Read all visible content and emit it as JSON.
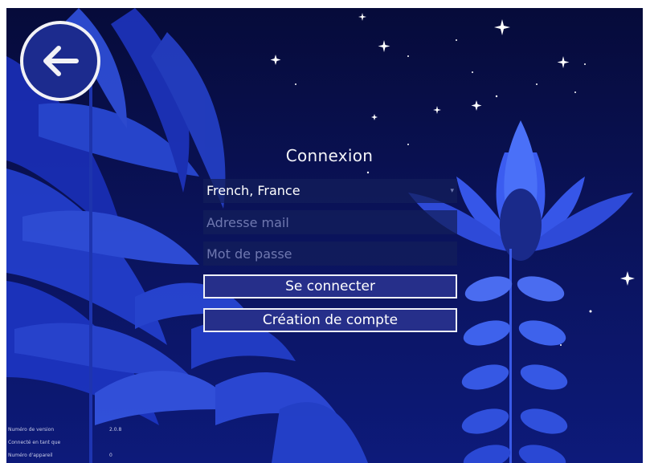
{
  "header": {
    "title": "Connexion"
  },
  "form": {
    "language": "French, France",
    "email_placeholder": "Adresse mail",
    "password_placeholder": "Mot de passe",
    "login_label": "Se connecter",
    "create_account_label": "Création de compte"
  },
  "footer": {
    "version_label": "Numéro de version",
    "version_value": "2.0.8",
    "connected_label": "Connecté en tant que",
    "device_label": "Numéro d'appareil",
    "device_value": "0"
  },
  "icons": {
    "back": "arrow-left-icon",
    "dropdown": "caret-down-icon"
  },
  "colors": {
    "background": "#0a1258",
    "button": "#262f8a",
    "field": "#141e5a"
  }
}
